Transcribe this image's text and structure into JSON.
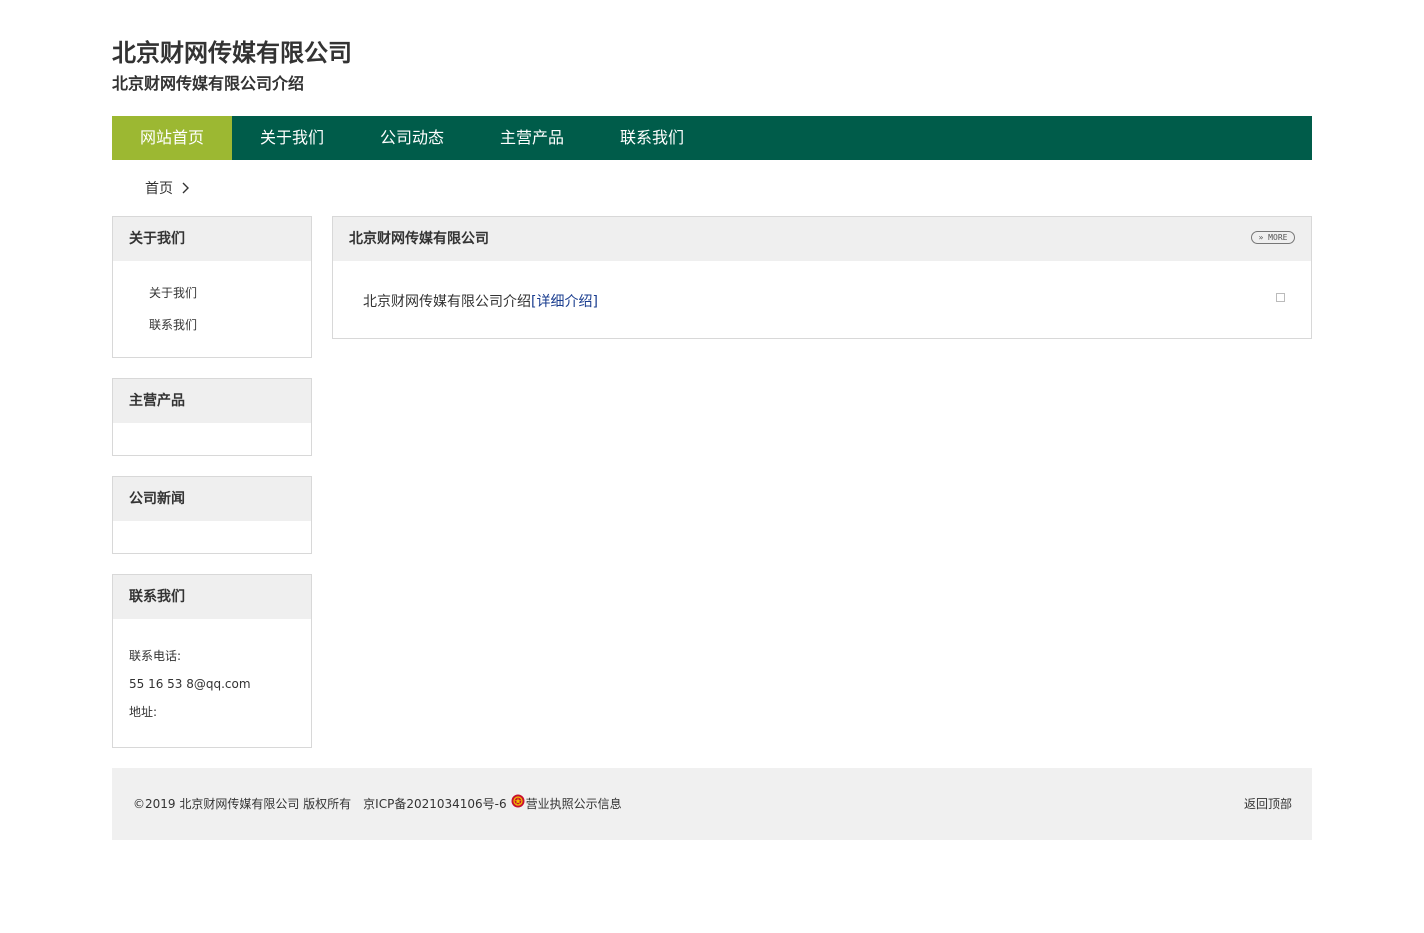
{
  "header": {
    "site_name": "北京财网传媒有限公司",
    "site_desc": "北京财网传媒有限公司介绍"
  },
  "nav": {
    "items": [
      {
        "label": "网站首页",
        "active": true
      },
      {
        "label": "关于我们",
        "active": false
      },
      {
        "label": "公司动态",
        "active": false
      },
      {
        "label": "主营产品",
        "active": false
      },
      {
        "label": "联系我们",
        "active": false
      }
    ],
    "colors": {
      "bar": "#005c4a",
      "active": "#9cb832"
    }
  },
  "breadcrumb": {
    "home": "首页",
    "separator_icon": "chevron-right-icon"
  },
  "sidebar": {
    "about": {
      "title": "关于我们",
      "links": [
        "关于我们",
        "联系我们"
      ]
    },
    "products": {
      "title": "主营产品"
    },
    "news": {
      "title": "公司新闻"
    },
    "contact": {
      "title": "联系我们",
      "phone": "联系电话:",
      "email": "55 16 53 8@qq.com",
      "address": "地址:"
    }
  },
  "main": {
    "title": "北京财网传媒有限公司",
    "more_label": "» MORE",
    "intro_text": "北京财网传媒有限公司介绍",
    "detail_link": "[详细介绍]"
  },
  "footer": {
    "copyright": "©2019 北京财网传媒有限公司 版权所有",
    "icp": "京ICP备2021034106号-6",
    "license": "营业执照公示信息",
    "license_icon": "national-emblem-icon",
    "back_to_top": "返回顶部"
  }
}
